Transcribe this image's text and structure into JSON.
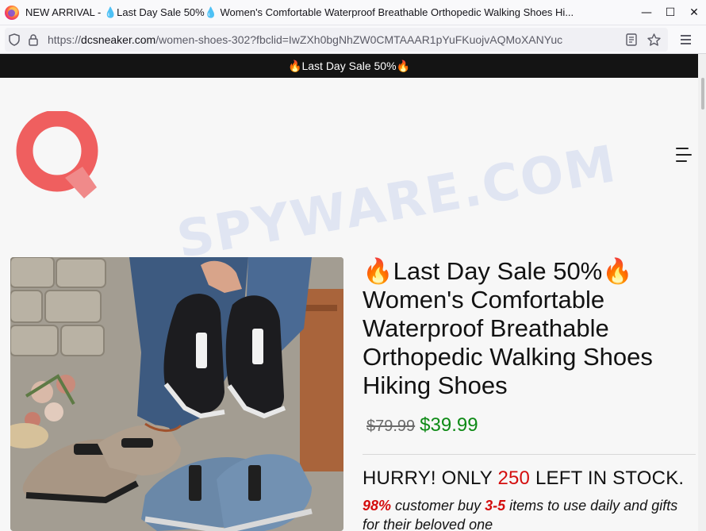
{
  "browser": {
    "window_title": "NEW ARRIVAL - 💧Last Day Sale 50%💧 Women's Comfortable Waterproof Breathable Orthopedic Walking Shoes Hi...",
    "url_prefix": "https://",
    "url_domain": "dcsneaker.com",
    "url_path": "/women-shoes-302?fbclid=IwZXh0bgNhZW0CMTAAAR1pYuFKuojvAQMoXANYuc",
    "controls": {
      "minimize": "—",
      "maximize": "☐",
      "close": "✕"
    },
    "icons": [
      "shield-icon",
      "lock-icon",
      "reader-view-icon",
      "bookmark-star-icon",
      "app-menu-icon"
    ]
  },
  "page": {
    "announcement": "🔥Last Day Sale 50%🔥",
    "watermark": "SPYWARE.COM",
    "logo_colors": {
      "ring": "#ef5f5f",
      "tail": "#f08a8a"
    },
    "product": {
      "title": "🔥Last Day Sale 50%🔥 Women's Comfortable Waterproof Breathable Orthopedic Walking Shoes Hiking Shoes",
      "old_price": "$79.99",
      "new_price": "$39.99",
      "hurry_prefix": "HURRY! ONLY ",
      "stock_count": "250",
      "hurry_suffix": " LEFT IN STOCK.",
      "promo_percent": "98%",
      "promo_text1": " customer buy ",
      "promo_range": "3-5",
      "promo_text2": " items to use daily and gifts for their beloved one"
    }
  },
  "colors": {
    "accent_green": "#0e8a16",
    "accent_red": "#d40e0e",
    "announce_bg": "#141414"
  }
}
